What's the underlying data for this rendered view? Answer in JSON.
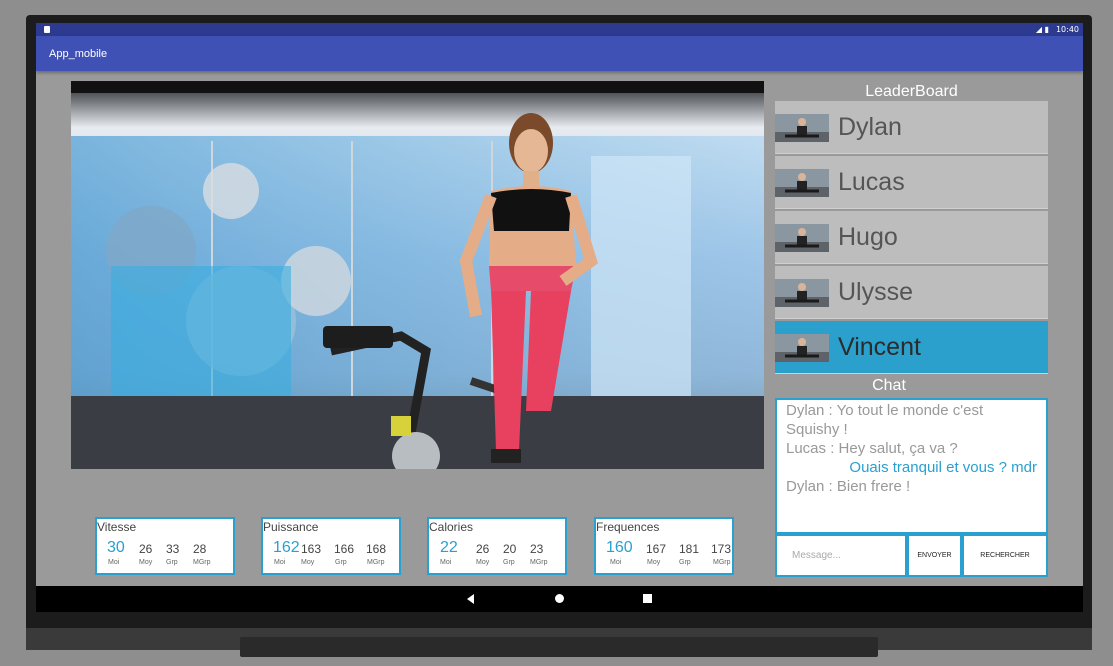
{
  "statusbar": {
    "time": "10:40"
  },
  "appbar": {
    "title": "App_mobile"
  },
  "stats": [
    {
      "title": "Vitesse",
      "main": "30",
      "moy": "26",
      "grp": "33",
      "mgrp": "28"
    },
    {
      "title": "Puissance",
      "main": "162",
      "moy": "163",
      "grp": "166",
      "mgrp": "168"
    },
    {
      "title": "Calories",
      "main": "22",
      "moy": "26",
      "grp": "20",
      "mgrp": "23"
    },
    {
      "title": "Frequences",
      "main": "160",
      "moy": "167",
      "grp": "181",
      "mgrp": "173"
    }
  ],
  "stat_labels": {
    "moi": "Moi",
    "moy": "Moy",
    "grp": "Grp",
    "mgrp": "MGrp"
  },
  "leaderboard": {
    "title": "LeaderBoard",
    "players": [
      "Dylan",
      "Lucas",
      "Hugo",
      "Ulysse",
      "Vincent"
    ],
    "active_index": 4
  },
  "chat": {
    "title": "Chat",
    "messages": [
      {
        "text": "Dylan : Yo tout le monde c'est Squishy !",
        "own": false
      },
      {
        "text": "Lucas : Hey salut, ça va ?",
        "own": false
      },
      {
        "text": "Ouais tranquil et vous ? mdr",
        "own": true
      },
      {
        "text": "Dylan : Bien frere !",
        "own": false
      }
    ],
    "input_placeholder": "Message...",
    "send_label": "ENVOYER",
    "search_label": "RECHERCHER"
  },
  "colors": {
    "primary": "#3f51b5",
    "primary_dark": "#2c3a8f",
    "accent": "#2aa0d0",
    "active_row": "#2ba0cc"
  },
  "icons": {
    "back": "back-triangle-icon",
    "home": "home-circle-icon",
    "recents": "recents-square-icon"
  }
}
